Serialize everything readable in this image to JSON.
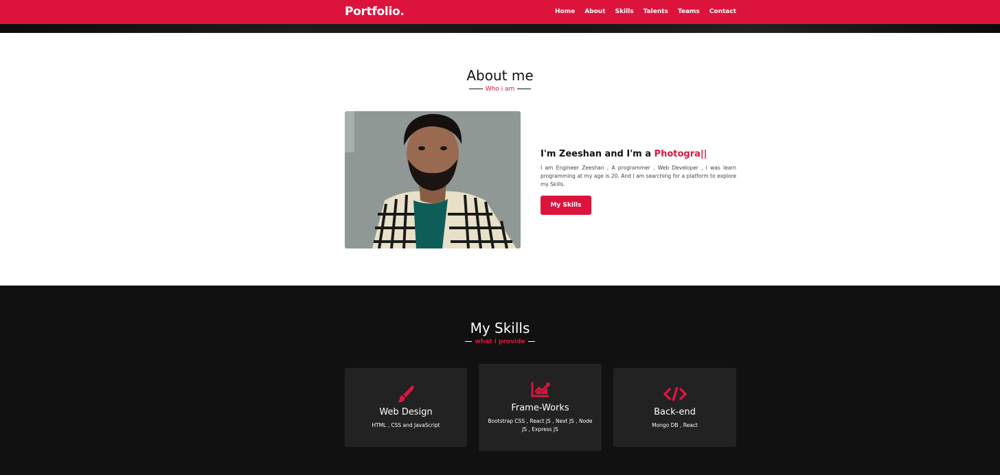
{
  "navbar": {
    "logo": "Portfolio.",
    "links": [
      "Home",
      "About",
      "Skills",
      "Talents",
      "Teams",
      "Contact"
    ]
  },
  "about": {
    "title": "About me",
    "subtitle": "Who i am",
    "heading_prefix": "I'm Zeeshan and I'm a ",
    "heading_typed": "Photogra||",
    "description": "I am Engineer Zeeshan , A programmer , Web Developer , I was learn programming at my age is 20. And I am searching for a platform to explore my Skills.",
    "button_label": "My Skills"
  },
  "skills": {
    "title": "My Skills",
    "subtitle": "what i provide",
    "cards": [
      {
        "icon": "paint-brush-icon",
        "title": "Web Design",
        "desc": "HTML , CSS and JavaScript"
      },
      {
        "icon": "chart-area-icon",
        "title": "Frame-Works",
        "desc": "Bootstrap CSS , React JS , Next JS , Node JS , Express JS"
      },
      {
        "icon": "code-icon",
        "title": "Back-end",
        "desc": "Mongo DB , React"
      }
    ]
  },
  "colors": {
    "accent": "#dc143c",
    "dark": "#111111",
    "card": "#222222"
  }
}
